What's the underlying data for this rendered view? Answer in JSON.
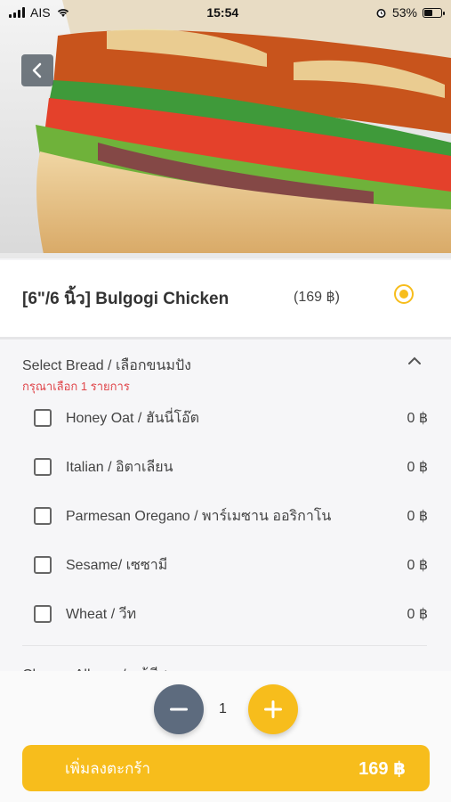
{
  "status_bar": {
    "carrier": "AIS",
    "time": "15:54",
    "battery": "53%",
    "battery_level": 0.53
  },
  "product": {
    "name": "[6\"/6 นิ้ว] Bulgogi Chicken",
    "price": "(169 ฿)"
  },
  "options": {
    "title": "Select Bread / เลือกขนมปัง",
    "required_note": "กรุณาเลือก 1 รายการ",
    "items": [
      {
        "label": "Honey Oat / ฮันนี่โอ๊ต",
        "price": "0 ฿"
      },
      {
        "label": "Italian / อิตาเลียน",
        "price": "0 ฿"
      },
      {
        "label": "Parmesan Oregano / พาร์เมซาน ออริกาโน",
        "price": "0 ฿"
      },
      {
        "label": "Sesame/ เซซามี",
        "price": "0 ฿"
      },
      {
        "label": "Wheat / วีท",
        "price": "0 ฿"
      }
    ],
    "next_section_title": "Cheese Allergy / แพ้ชีส"
  },
  "quantity": {
    "value": "1"
  },
  "cart": {
    "label": "เพิ่มลงตะกร้า",
    "total": "169 ฿"
  },
  "colors": {
    "accent": "#f7bd1c",
    "minus_button": "#5d6b7e",
    "required_text": "#e0454a"
  },
  "icons": [
    "back-chevron-icon",
    "chevron-up-icon",
    "minus-icon",
    "plus-icon",
    "wifi-icon",
    "alarm-icon",
    "battery-icon",
    "signal-icon"
  ]
}
